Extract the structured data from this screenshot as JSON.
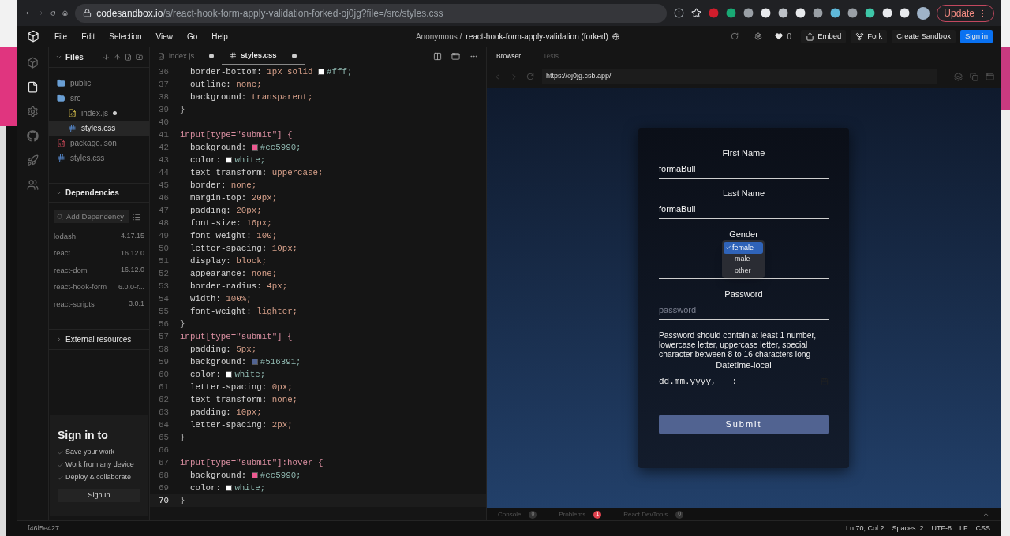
{
  "browser": {
    "address": {
      "host": "codesandbox.io",
      "path": "/s/react-hook-form-apply-validation-forked-oj0jg?file=/src/styles.css"
    },
    "update_button": "Update"
  },
  "header": {
    "menus": [
      "File",
      "Edit",
      "Selection",
      "View",
      "Go",
      "Help"
    ],
    "owner": "Anonymous /",
    "project": "react-hook-form-apply-validation (forked)",
    "likes": "0",
    "buttons": [
      {
        "label": "Embed",
        "kind": "embed"
      },
      {
        "label": "Fork",
        "kind": "fork"
      },
      {
        "label": "Create Sandbox",
        "kind": "plain"
      },
      {
        "label": "Sign in",
        "kind": "primary"
      }
    ]
  },
  "activity_bar": [
    {
      "kind": "sandbox",
      "selected": false
    },
    {
      "kind": "files",
      "selected": true
    },
    {
      "kind": "settings",
      "selected": false
    },
    {
      "kind": "github",
      "selected": false
    },
    {
      "kind": "deploy",
      "selected": false
    },
    {
      "kind": "live",
      "selected": false
    }
  ],
  "sidebar": {
    "files_title": "Files",
    "tree": [
      {
        "name": "public",
        "kind": "folder",
        "expanded": false,
        "selected": false,
        "modified": false
      },
      {
        "name": "src",
        "kind": "folder",
        "expanded": true,
        "selected": false,
        "modified": false,
        "children": [
          {
            "name": "index.js",
            "kind": "js",
            "selected": false,
            "modified": true
          },
          {
            "name": "styles.css",
            "kind": "css",
            "selected": true,
            "modified": false
          }
        ]
      },
      {
        "name": "package.json",
        "kind": "json",
        "selected": false,
        "modified": false
      },
      {
        "name": "styles.css",
        "kind": "css",
        "selected": false,
        "modified": false
      }
    ],
    "dependencies_title": "Dependencies",
    "dependency_search": {
      "placeholder": "Add Dependency"
    },
    "dependencies": [
      {
        "name": "lodash",
        "version": "4.17.15"
      },
      {
        "name": "react",
        "version": "16.12.0"
      },
      {
        "name": "react-dom",
        "version": "16.12.0"
      },
      {
        "name": "react-hook-form",
        "version": "6.0.0-r..."
      },
      {
        "name": "react-scripts",
        "version": "3.0.1"
      }
    ],
    "external_title": "External resources",
    "signin": {
      "title": "Sign in to",
      "benefits": [
        "Save your work",
        "Work from any device",
        "Deploy & collaborate"
      ],
      "button": "Sign In"
    }
  },
  "editor": {
    "tabs": [
      {
        "label": "index.js",
        "kind": "js",
        "selected": false,
        "modified": true
      },
      {
        "label": "styles.css",
        "kind": "css",
        "selected": true,
        "modified": true
      }
    ],
    "lines": [
      {
        "number": "36",
        "kind": "declaration",
        "property": "border-bottom:",
        "value": "1px solid",
        "swatch": {
          "color": "#ffffff",
          "text": "#fff;"
        },
        "current": false
      },
      {
        "number": "37",
        "kind": "declaration",
        "property": "outline:",
        "value": "none;",
        "current": false
      },
      {
        "number": "38",
        "kind": "declaration",
        "property": "background:",
        "value": "transparent;",
        "current": false
      },
      {
        "number": "39",
        "kind": "brace",
        "text": "}",
        "current": false
      },
      {
        "number": "40",
        "kind": "blank",
        "current": false
      },
      {
        "number": "41",
        "kind": "selector",
        "text": "input[type=\"submit\"] {",
        "current": false
      },
      {
        "number": "42",
        "kind": "declaration",
        "property": "background:",
        "swatch": {
          "color": "#ec5990",
          "text": "#ec5990;"
        },
        "current": false
      },
      {
        "number": "43",
        "kind": "declaration",
        "property": "color:",
        "swatch": {
          "color": "#ffffff",
          "text": "white;"
        },
        "current": false
      },
      {
        "number": "44",
        "kind": "declaration",
        "property": "text-transform:",
        "value": "uppercase;",
        "current": false
      },
      {
        "number": "45",
        "kind": "declaration",
        "property": "border:",
        "value": "none;",
        "current": false
      },
      {
        "number": "46",
        "kind": "declaration",
        "property": "margin-top:",
        "value": "20px;",
        "current": false
      },
      {
        "number": "47",
        "kind": "declaration",
        "property": "padding:",
        "value": "20px;",
        "current": false
      },
      {
        "number": "48",
        "kind": "declaration",
        "property": "font-size:",
        "value": "16px;",
        "current": false
      },
      {
        "number": "49",
        "kind": "declaration",
        "property": "font-weight:",
        "value": "100;",
        "current": false
      },
      {
        "number": "50",
        "kind": "declaration",
        "property": "letter-spacing:",
        "value": "10px;",
        "current": false
      },
      {
        "number": "51",
        "kind": "declaration",
        "property": "display:",
        "value": "block;",
        "current": false
      },
      {
        "number": "52",
        "kind": "declaration",
        "property": "appearance:",
        "value": "none;",
        "current": false
      },
      {
        "number": "53",
        "kind": "declaration",
        "property": "border-radius:",
        "value": "4px;",
        "current": false
      },
      {
        "number": "54",
        "kind": "declaration",
        "property": "width:",
        "value": "100%;",
        "current": false
      },
      {
        "number": "55",
        "kind": "declaration",
        "property": "font-weight:",
        "value": "lighter;",
        "current": false
      },
      {
        "number": "56",
        "kind": "brace",
        "text": "}",
        "current": false
      },
      {
        "number": "57",
        "kind": "selector",
        "text": "input[type=\"submit\"] {",
        "current": false
      },
      {
        "number": "58",
        "kind": "declaration",
        "property": "padding:",
        "value": "5px;",
        "current": false
      },
      {
        "number": "59",
        "kind": "declaration",
        "property": "background:",
        "swatch": {
          "color": "#516391",
          "text": "#516391;"
        },
        "current": false
      },
      {
        "number": "60",
        "kind": "declaration",
        "property": "color:",
        "swatch": {
          "color": "#ffffff",
          "text": "white;"
        },
        "current": false
      },
      {
        "number": "61",
        "kind": "declaration",
        "property": "letter-spacing:",
        "value": "0px;",
        "current": false
      },
      {
        "number": "62",
        "kind": "declaration",
        "property": "text-transform:",
        "value": "none;",
        "current": false
      },
      {
        "number": "63",
        "kind": "declaration",
        "property": "padding:",
        "value": "10px;",
        "current": false
      },
      {
        "number": "64",
        "kind": "declaration",
        "property": "letter-spacing:",
        "value": "2px;",
        "current": false
      },
      {
        "number": "65",
        "kind": "brace",
        "text": "}",
        "current": false
      },
      {
        "number": "66",
        "kind": "blank",
        "current": false
      },
      {
        "number": "67",
        "kind": "selector",
        "text": "input[type=\"submit\"]:hover {",
        "current": false
      },
      {
        "number": "68",
        "kind": "declaration",
        "property": "background:",
        "swatch": {
          "color": "#ec5990",
          "text": "#ec5990;"
        },
        "current": false
      },
      {
        "number": "69",
        "kind": "declaration",
        "property": "color:",
        "swatch": {
          "color": "#ffffff",
          "text": "white;"
        },
        "current": false
      },
      {
        "number": "70",
        "kind": "brace",
        "text": "}",
        "current": true
      }
    ]
  },
  "preview": {
    "tabs": [
      {
        "label": "Browser",
        "selected": true
      },
      {
        "label": "Tests",
        "selected": false
      }
    ],
    "url": "https://oj0jg.csb.app/",
    "form": {
      "fields": [
        {
          "kind": "text",
          "label": "First Name",
          "value": "formaBull"
        },
        {
          "kind": "text",
          "label": "Last Name",
          "value": "formaBull"
        },
        {
          "kind": "select",
          "label": "Gender",
          "options": [
            {
              "label": "female",
              "selected": true
            },
            {
              "label": "male",
              "selected": false
            },
            {
              "label": "other",
              "selected": false
            }
          ]
        },
        {
          "kind": "password",
          "label": "Password",
          "placeholder": "password",
          "hint": "Password should contain at least 1 number, lowercase letter, uppercase letter, special character between 8 to 16 characters long"
        },
        {
          "kind": "datetime",
          "label": "Datetime-local",
          "value": "dd.mm.yyyy, --:--"
        }
      ],
      "submit": "Submit"
    },
    "panel_tabs": [
      {
        "label": "Console",
        "count": "0",
        "alert": false
      },
      {
        "label": "Problems",
        "count": "1",
        "alert": true
      },
      {
        "label": "React DevTools",
        "count": "0",
        "alert": false
      }
    ]
  },
  "status_bar": {
    "commit": "f46f5e427",
    "items": [
      "Ln 70, Col 2",
      "Spaces: 2",
      "UTF-8",
      "LF",
      "CSS"
    ]
  }
}
